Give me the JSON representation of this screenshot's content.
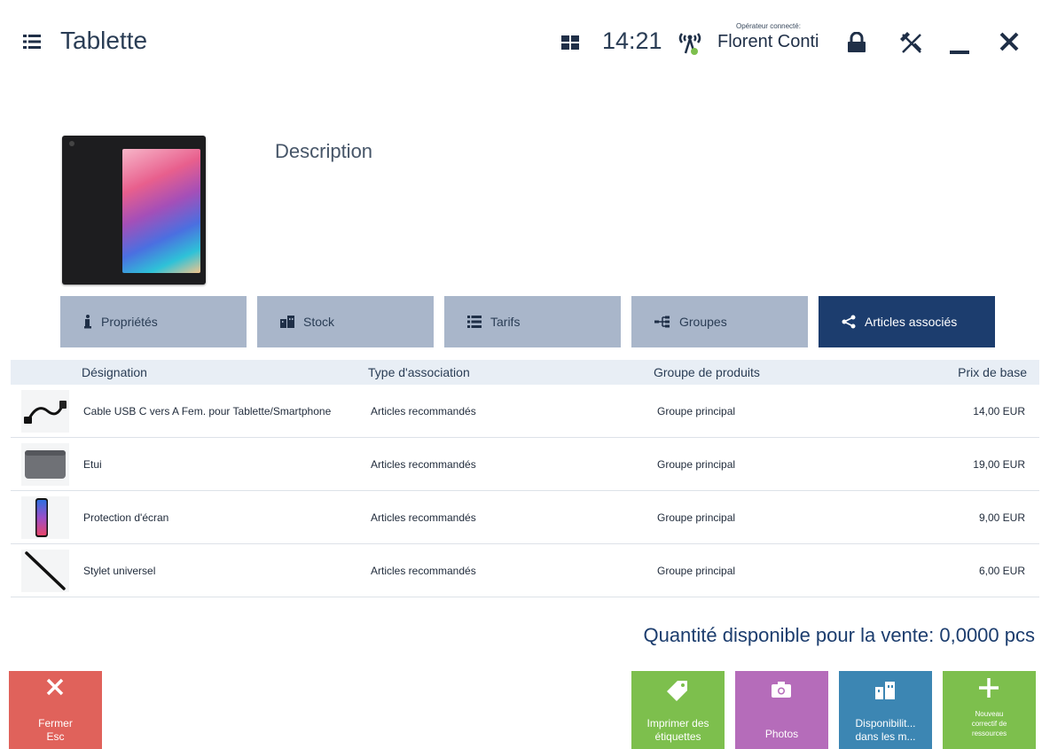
{
  "header": {
    "title": "Tablette",
    "time": "14:21",
    "operator_caption": "Opérateur connecté:",
    "operator_name": "Florent Conti"
  },
  "product": {
    "description_label": "Description"
  },
  "tabs": [
    {
      "label": "Propriétés",
      "icon": "info-icon"
    },
    {
      "label": "Stock",
      "icon": "buildings-icon"
    },
    {
      "label": "Tarifs",
      "icon": "list-icon"
    },
    {
      "label": "Groupes",
      "icon": "hierarchy-icon"
    },
    {
      "label": "Articles associés",
      "icon": "share-icon",
      "active": true
    }
  ],
  "table": {
    "columns": [
      "Désignation",
      "Type d'association",
      "Groupe de produits",
      "Prix de base"
    ],
    "rows": [
      {
        "name": "Cable USB C vers A Fem. pour Tablette/Smartphone",
        "type": "Articles recommandés",
        "group": "Groupe principal",
        "price": "14,00 EUR",
        "thumb": "usb-cable"
      },
      {
        "name": "Etui",
        "type": "Articles recommandés",
        "group": "Groupe principal",
        "price": "19,00 EUR",
        "thumb": "sleeve-case"
      },
      {
        "name": "Protection d'écran",
        "type": "Articles recommandés",
        "group": "Groupe principal",
        "price": "9,00 EUR",
        "thumb": "screen-protector"
      },
      {
        "name": "Stylet universel",
        "type": "Articles recommandés",
        "group": "Groupe principal",
        "price": "6,00 EUR",
        "thumb": "stylus"
      }
    ]
  },
  "availability": "Quantité disponible pour la vente:  0,0000 pcs",
  "buttons": {
    "close": {
      "line1": "Fermer",
      "line2": "Esc"
    },
    "labels": {
      "line1": "Imprimer des",
      "line2": "étiquettes"
    },
    "photos": {
      "line1": "Photos"
    },
    "dispo": {
      "line1": "Disponibilit...",
      "line2": "dans les m..."
    },
    "new": {
      "line1": "Nouveau",
      "line2": "correctif de",
      "line3": "ressources"
    }
  },
  "colors": {
    "accent": "#1c3d6e",
    "tab_inactive": "#a9b6ca",
    "close_button": "#e0625b",
    "green_button": "#7dbf4d",
    "purple_button": "#b56cba",
    "blue_button": "#3c86b3"
  }
}
